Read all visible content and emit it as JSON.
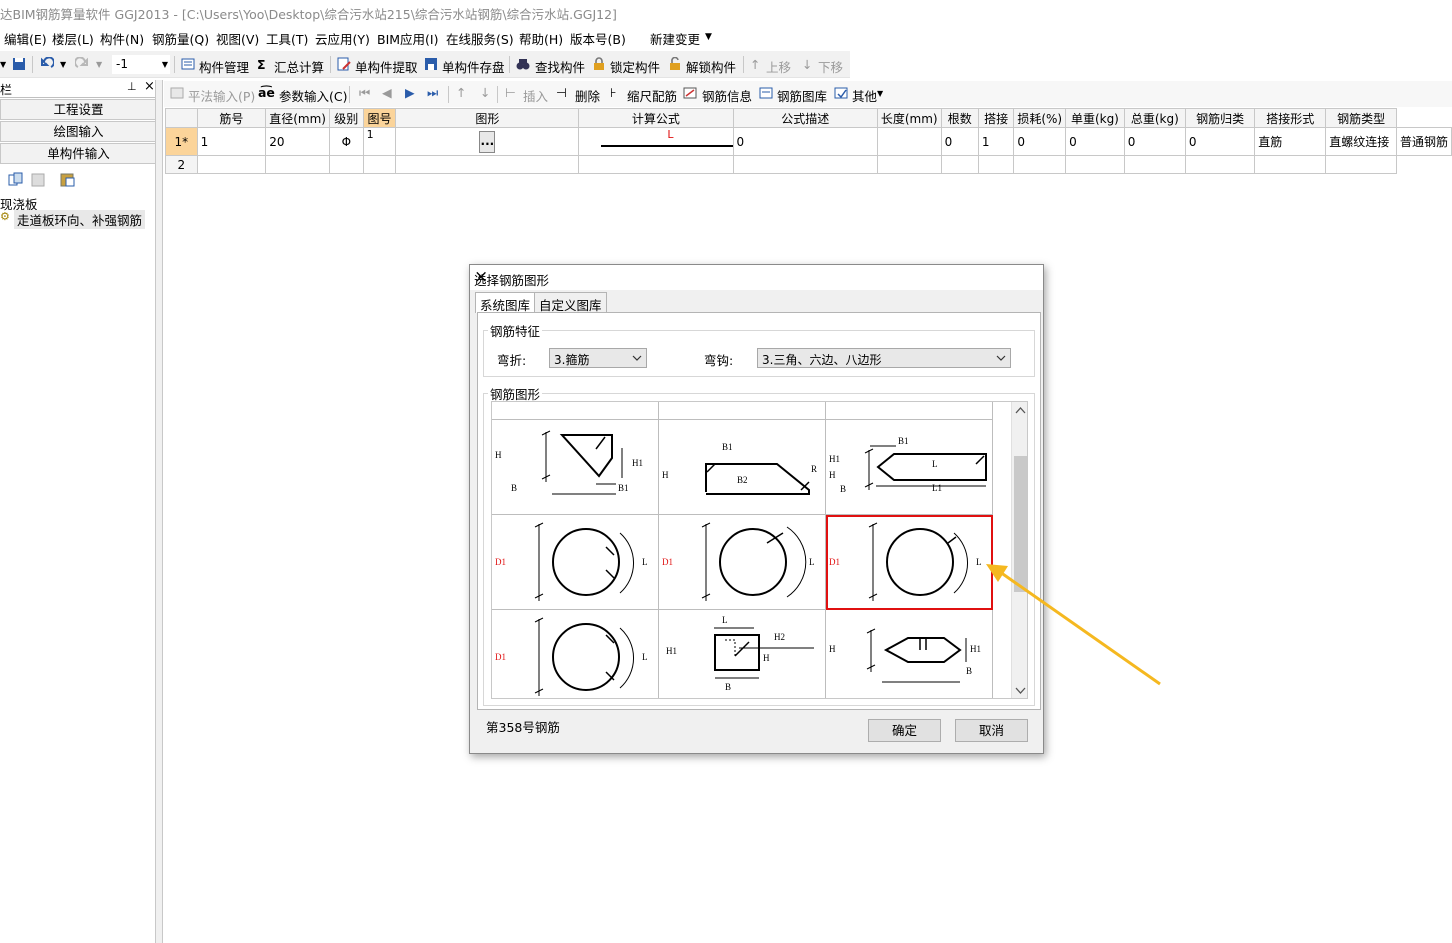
{
  "window": {
    "title": "达BIM钢筋算量软件 GGJ2013 - [C:\\Users\\Yoo\\Desktop\\综合污水站215\\综合污水站钢筋\\综合污水站.GGJ12]"
  },
  "menu": [
    "编辑(E)",
    "楼层(L)",
    "构件(N)",
    "钢筋量(Q)",
    "视图(V)",
    "工具(T)",
    "云应用(Y)",
    "BIM应用(I)",
    "在线服务(S)",
    "帮助(H)",
    "版本号(B)",
    "新建变更"
  ],
  "toolbar": {
    "floor_value": "-1",
    "items": [
      "构件管理",
      "汇总计算",
      "单构件提取",
      "单构件存盘",
      "查找构件",
      "锁定构件",
      "解锁构件",
      "上移",
      "下移"
    ]
  },
  "left_panel": {
    "header": "栏",
    "nav": [
      "工程设置",
      "绘图输入",
      "单构件输入"
    ],
    "tree_root": "现浇板",
    "tree_child": "走道板环向、补强钢筋"
  },
  "editor_toolbar": [
    "平法输入(P)",
    "参数输入(C)",
    "插入",
    "删除",
    "缩尺配筋",
    "钢筋信息",
    "钢筋图库",
    "其他"
  ],
  "grid": {
    "columns": [
      "筋号",
      "直径(mm)",
      "级别",
      "图号",
      "图形",
      "计算公式",
      "公式描述",
      "长度(mm)",
      "根数",
      "搭接",
      "损耗(%)",
      "单重(kg)",
      "总重(kg)",
      "钢筋归类",
      "搭接形式",
      "钢筋类型"
    ],
    "rows": [
      {
        "no": "1*",
        "cells": [
          "1",
          "20",
          "Φ",
          "1",
          "L",
          "0",
          "",
          "0",
          "1",
          "0",
          "0",
          "0",
          "0",
          "直筋",
          "直螺纹连接",
          "普通钢筋"
        ]
      },
      {
        "no": "2",
        "cells": [
          "",
          "",
          "",
          "",
          "",
          "",
          "",
          "",
          "",
          "",
          "",
          "",
          "",
          "",
          "",
          ""
        ]
      }
    ],
    "ellipsis": "..."
  },
  "dialog": {
    "title": "选择钢筋图形",
    "close": "×",
    "tabs": [
      "系统图库",
      "自定义图库"
    ],
    "features_legend": "钢筋特征",
    "bend_label": "弯折:",
    "bend_value": "3.箍筋",
    "hook_label": "弯钩:",
    "hook_value": "3.三角、六边、八边形",
    "shapes_legend": "钢筋图形",
    "status": "第358号钢筋",
    "ok": "确定",
    "cancel": "取消",
    "shape_labels": {
      "c1": {
        "h": "H",
        "b": "B",
        "h1": "H1",
        "b1": "B1"
      },
      "c2": {
        "h": "H",
        "b1": "B1",
        "b2": "B2",
        "r": "R"
      },
      "c3": {
        "h1": "H1",
        "h": "H",
        "b": "B",
        "b1": "B1",
        "l": "L",
        "l1": "L1"
      },
      "c4": {
        "d1": "D1",
        "l": "L"
      },
      "c5": {
        "d1": "D1",
        "l": "L"
      },
      "c6": {
        "d1": "D1",
        "l": "L"
      },
      "c7": {
        "d1": "D1",
        "l": "L"
      },
      "c8": {
        "h1": "H1",
        "l": "L",
        "h2": "H2",
        "h": "H",
        "b": "B"
      },
      "c9": {
        "h": "H",
        "h1": "H1",
        "b": "B"
      }
    }
  },
  "colors": {
    "accent_red": "#e01010",
    "arrow": "#f5b820",
    "selected_row": "#fbd49a"
  }
}
